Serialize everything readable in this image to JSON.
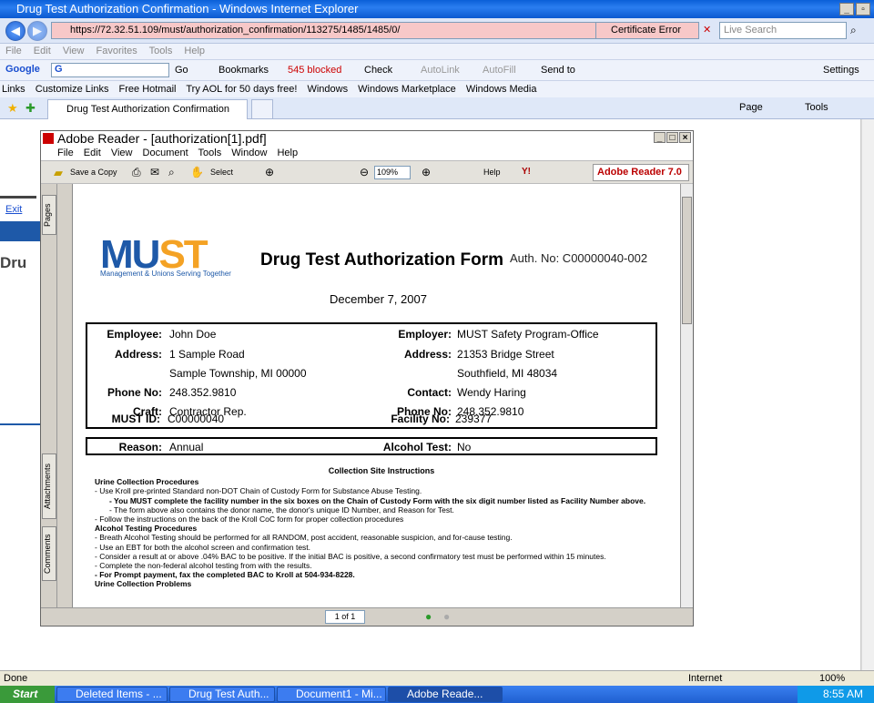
{
  "ie": {
    "title": "Drug Test Authorization Confirmation - Windows Internet Explorer",
    "url": "https://72.32.51.109/must/authorization_confirmation/113275/1485/1485/0/",
    "cert_error": "Certificate Error",
    "search_placeholder": "Live Search",
    "menu": [
      "File",
      "Edit",
      "View",
      "Favorites",
      "Tools",
      "Help"
    ],
    "google": {
      "brand": "Google",
      "g": "G",
      "go": "Go",
      "bookmarks": "Bookmarks",
      "blocked": "545 blocked",
      "check": "Check",
      "autolink": "AutoLink",
      "autofill": "AutoFill",
      "sendto": "Send to",
      "settings": "Settings"
    },
    "links_label": "Links",
    "links": [
      "Customize Links",
      "Free Hotmail",
      "Try AOL for 50 days free!",
      "Windows",
      "Windows Marketplace",
      "Windows Media"
    ],
    "tab": "Drug Test Authorization Confirmation",
    "cmd": {
      "page": "Page",
      "tools": "Tools"
    },
    "status": "Done",
    "zone": "Internet",
    "zoom": "100%"
  },
  "behind": {
    "exit": "Exit",
    "heading": "Dru"
  },
  "reader": {
    "title": "Adobe Reader - [authorization[1].pdf]",
    "menu": [
      "File",
      "Edit",
      "View",
      "Document",
      "Tools",
      "Window",
      "Help"
    ],
    "tools": {
      "save": "Save a Copy",
      "select": "Select",
      "zoom": "109%",
      "help": "Help",
      "y": "Y!"
    },
    "brand": "Adobe Reader 7.0",
    "side_tabs": {
      "pages": "Pages",
      "attachments": "Attachments",
      "comments": "Comments"
    },
    "page_count": "1 of 1"
  },
  "doc": {
    "logo_mu": "MU",
    "logo_st": "ST",
    "tagline": "Management & Unions Serving Together",
    "title": "Drug Test Authorization Form",
    "auth_no": "Auth. No: C00000040-002",
    "date": "December 7, 2007",
    "employee": {
      "label": "Employee:",
      "value": "John Doe"
    },
    "address": {
      "label": "Address:",
      "line1": "1 Sample Road",
      "line2": "Sample Township, MI 00000"
    },
    "phone": {
      "label": "Phone No:",
      "value": "248.352.9810"
    },
    "craft": {
      "label": "Craft:",
      "value": "Contractor Rep."
    },
    "must_id": {
      "label": "MUST ID:",
      "value": "C00000040"
    },
    "employer": {
      "label": "Employer:",
      "value": "MUST Safety Program-Office"
    },
    "emp_address": {
      "label": "Address:",
      "line1": "21353 Bridge Street",
      "line2": "Southfield, MI 48034"
    },
    "contact": {
      "label": "Contact:",
      "value": "Wendy Haring"
    },
    "emp_phone": {
      "label": "Phone No:",
      "value": "248.352.9810"
    },
    "facility": {
      "label": "Facility No:",
      "value": "239377"
    },
    "reason": {
      "label": "Reason:",
      "value": "Annual"
    },
    "alcohol": {
      "label": "Alcohol Test:",
      "value": "No"
    },
    "instr_title": "Collection Site Instructions",
    "urine_head": "Urine Collection Procedures",
    "urine": [
      "- Use Kroll pre-printed Standard non-DOT Chain of Custody Form for Substance Abuse Testing.",
      "- You MUST complete the facility number in the six boxes on the Chain of Custody Form with the six digit number listed as Facility Number above.",
      "- The form above also contains the donor name, the donor's unique ID Number, and Reason for Test.",
      "- Follow the instructions on the back of the Kroll CoC form for proper collection procedures"
    ],
    "alcohol_head": "Alcohol Testing Procedures",
    "alcohol_items": [
      "- Breath Alcohol Testing should be performed for all RANDOM, post accident, reasonable suspicion, and for-cause testing.",
      "- Use an EBT for both the alcohol screen and confirmation test.",
      "- Consider a result at or above .04% BAC to be positive. If the initial BAC is positive, a second confirmatory test must be performed within 15 minutes.",
      "- Complete the non-federal alcohol testing from with the results.",
      "- For Prompt payment, fax the completed BAC to Kroll at 504-934-8228."
    ],
    "problems_head": "Urine Collection Problems"
  },
  "taskbar": {
    "start": "Start",
    "items": [
      "Deleted Items - ...",
      "Drug Test Auth...",
      "Document1 - Mi...",
      "Adobe Reade..."
    ],
    "time": "8:55 AM"
  }
}
